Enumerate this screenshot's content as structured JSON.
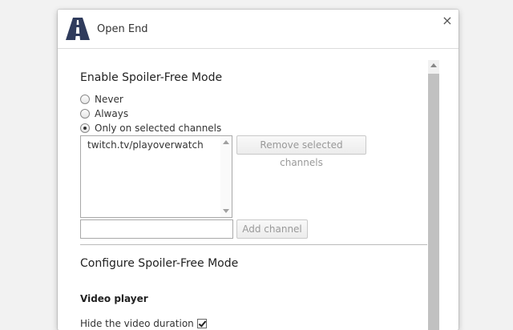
{
  "header": {
    "title": "Open End",
    "logo": "road-logo-icon",
    "close": "×"
  },
  "enable_section": {
    "title": "Enable Spoiler-Free Mode",
    "options": [
      {
        "label": "Never",
        "checked": false
      },
      {
        "label": "Always",
        "checked": false
      },
      {
        "label": "Only on selected channels",
        "checked": true
      }
    ],
    "channels": [
      "twitch.tv/playoverwatch"
    ],
    "remove_button": "Remove selected channels",
    "add_input_value": "",
    "add_button": "Add channel"
  },
  "configure_section": {
    "title": "Configure Spoiler-Free Mode",
    "subheading": "Video player",
    "hide_duration": {
      "label": "Hide the video duration",
      "checked": true
    }
  },
  "colors": {
    "logo": "#2f3b5c",
    "disabled_text": "#999999"
  }
}
